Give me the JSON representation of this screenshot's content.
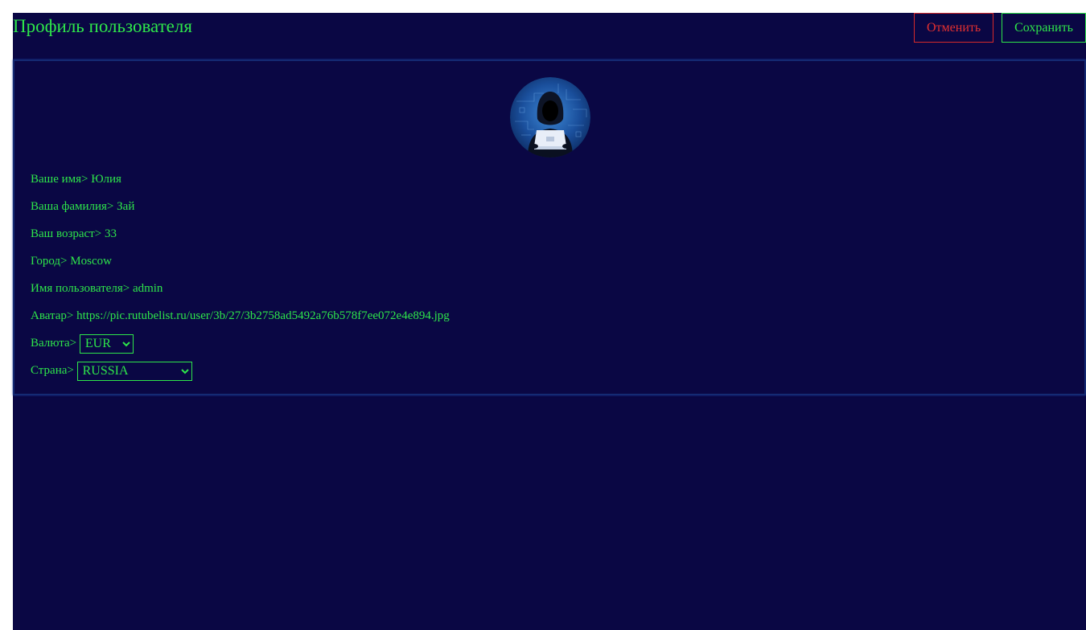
{
  "header": {
    "title": "Профиль пользователя",
    "cancel_label": "Отменить",
    "save_label": "Сохранить"
  },
  "profile": {
    "first_name_label": "Ваше имя>",
    "first_name": "Юлия",
    "last_name_label": "Ваша фамилия>",
    "last_name": "Зай",
    "age_label": "Ваш возраст>",
    "age": "33",
    "city_label": "Город>",
    "city": "Moscow",
    "username_label": "Имя пользователя>",
    "username": "admin",
    "avatar_label": "Аватар>",
    "avatar_url": "https://pic.rutubelist.ru/user/3b/27/3b2758ad5492a76b578f7ee072e4e894.jpg",
    "currency_label": "Валюта>",
    "currency": "EUR",
    "country_label": "Страна>",
    "country": "RUSSIA"
  },
  "colors": {
    "background": "#0a0744",
    "text": "#2ee64a",
    "cancel": "#e33030",
    "card_border": "#142a73"
  },
  "icons": {
    "avatar": "hooded-hacker-avatar"
  }
}
